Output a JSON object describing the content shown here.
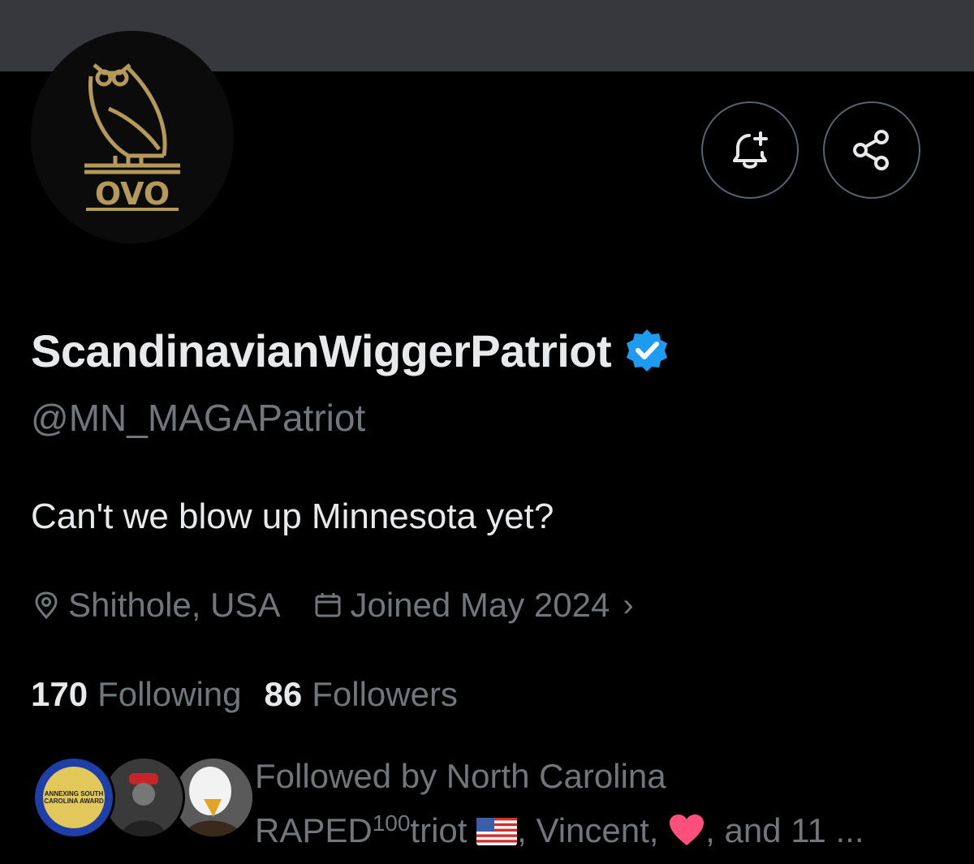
{
  "profile": {
    "display_name": "ScandinavianWiggerPatriot",
    "handle": "@MN_MAGAPatriot",
    "bio": "Can't we blow up Minnesota yet?",
    "location": "Shithole, USA",
    "joined": "Joined May 2024",
    "verified": true,
    "avatar_logo_text": "OVO",
    "accent_color": "#1d9bf0",
    "logo_color": "#b49a5a"
  },
  "stats": {
    "following_count": "170",
    "following_label": "Following",
    "followers_count": "86",
    "followers_label": "Followers"
  },
  "followed_by": {
    "prefix": "Followed by North Carolina",
    "name1_start": "RAPED",
    "name1_sup": "100",
    "name1_end": "triot",
    "sep1": ", Vincent, ",
    "suffix": ", and 11 ...",
    "award_text": "ANNEXING SOUTH CAROLINA AWARD"
  },
  "icons": {
    "notify": "bell-plus-icon",
    "share": "share-icon",
    "location": "location-pin-icon",
    "calendar": "calendar-icon",
    "verified": "verified-badge-icon",
    "chevron": "chevron-right-icon"
  }
}
